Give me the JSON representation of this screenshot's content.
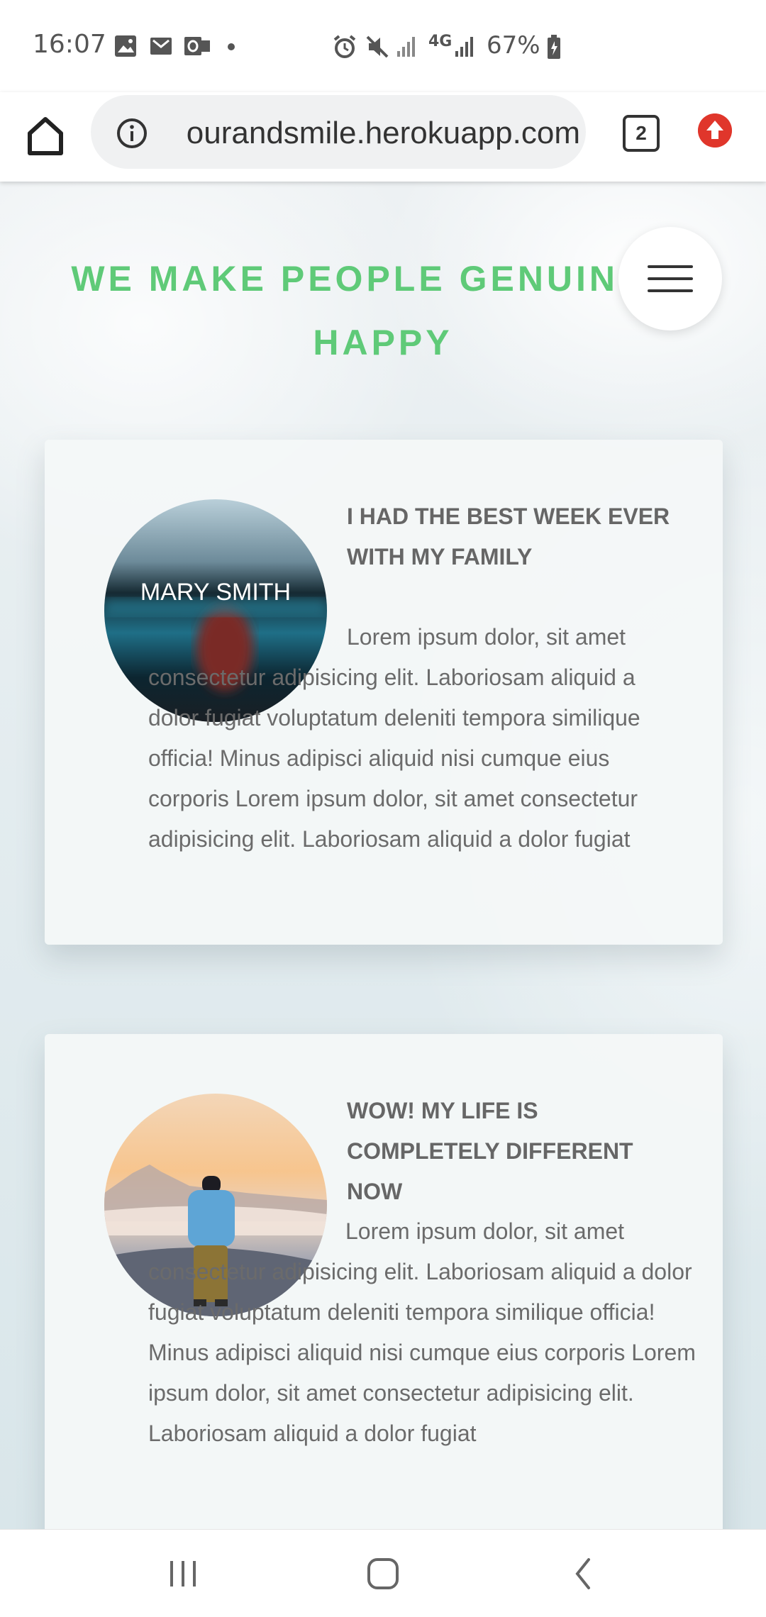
{
  "status_bar": {
    "time": "16:07",
    "battery": "67%",
    "network": "4G",
    "icons": [
      "gallery-icon",
      "gmail-icon",
      "outlook-icon",
      "dot-icon",
      "alarm-icon",
      "mute-icon",
      "signal-icon",
      "network-4g-icon",
      "signal-icon",
      "battery-charging-icon"
    ]
  },
  "browser": {
    "url": "ourandsmile.herokuapp.com",
    "tab_count": "2",
    "icons": {
      "home": "home-icon",
      "info": "info-icon",
      "update": "update-arrow-icon"
    }
  },
  "page": {
    "hero_title": "WE MAKE PEOPLE GENUINELY HAPPY",
    "colors": {
      "accent": "#5fca78",
      "text": "#6b6b6b",
      "card": "#f4f7f8"
    },
    "testimonials": [
      {
        "avatar_name": "MARY SMITH",
        "title": "I HAD THE BEST WEEK EVER WITH MY FAMILY",
        "body": "Lorem ipsum dolor, sit amet consectetur adipisicing elit. Laboriosam aliquid a dolor fugiat voluptatum deleniti tempora similique officia! Minus adipisci aliquid nisi cumque eius corporis Lorem ipsum dolor, sit amet consectetur adipisicing elit. Laboriosam aliquid a dolor fugiat"
      },
      {
        "avatar_name": "",
        "title": "WOW! MY LIFE IS COMPLETELY DIFFERENT NOW",
        "body": "Lorem ipsum dolor, sit amet consectetur adipisicing elit. Laboriosam aliquid a dolor fugiat voluptatum deleniti tempora similique officia! Minus adipisci aliquid nisi cumque eius corporis Lorem ipsum dolor, sit amet consectetur adipisicing elit. Laboriosam aliquid a dolor fugiat"
      }
    ]
  },
  "nav_bar": {
    "icons": [
      "recent-apps-icon",
      "home-button-icon",
      "back-icon"
    ]
  }
}
